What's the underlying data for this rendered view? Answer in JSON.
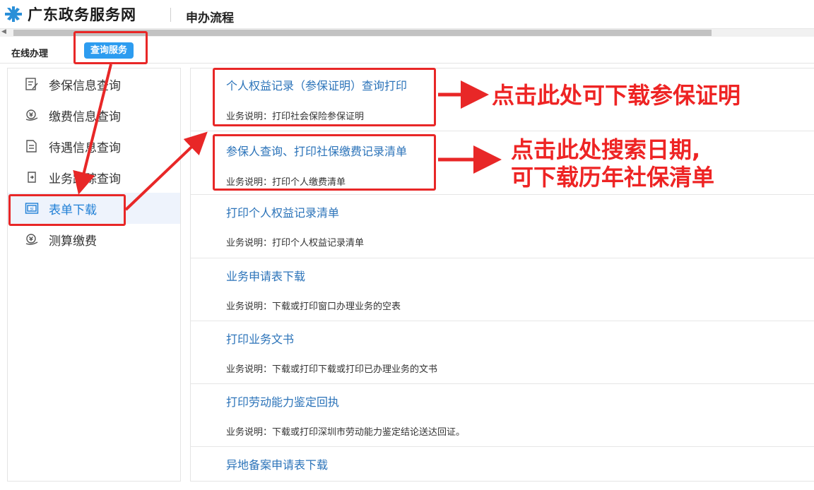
{
  "header": {
    "site_title": "广东政务服务网",
    "page_title": "申办流程"
  },
  "tabs": {
    "online": "在线办理",
    "query": "查询服务"
  },
  "sidebar": {
    "items": [
      {
        "label": "参保信息查询",
        "icon": "form-edit-icon"
      },
      {
        "label": "缴费信息查询",
        "icon": "payment-icon"
      },
      {
        "label": "待遇信息查询",
        "icon": "document-icon"
      },
      {
        "label": "业务跟踪查询",
        "icon": "tracking-icon"
      },
      {
        "label": "表单下载",
        "icon": "si-form-icon"
      },
      {
        "label": "测算缴费",
        "icon": "calculate-icon"
      }
    ],
    "active_index": 4
  },
  "entries": [
    {
      "title": "个人权益记录（参保证明）查询打印",
      "desc": "业务说明：打印社会保险参保证明"
    },
    {
      "title": "参保人查询、打印社保缴费记录清单",
      "desc": "业务说明：打印个人缴费清单"
    },
    {
      "title": "打印个人权益记录清单",
      "desc": "业务说明：打印个人权益记录清单"
    },
    {
      "title": "业务申请表下载",
      "desc": "业务说明：下载或打印窗口办理业务的空表"
    },
    {
      "title": "打印业务文书",
      "desc": "业务说明：下载或打印下载或打印已办理业务的文书"
    },
    {
      "title": "打印劳动能力鉴定回执",
      "desc": "业务说明：下载或打印深圳市劳动能力鉴定结论送达回证。"
    },
    {
      "title": "异地备案申请表下载",
      "desc": ""
    }
  ],
  "annotations": {
    "callout_1": "点击此处可下载参保证明",
    "callout_2_line1": "点击此处搜索日期,",
    "callout_2_line2": "可下载历年社保清单"
  },
  "colors": {
    "accent_blue": "#2d9cf0",
    "link_blue": "#2b73b9",
    "annotation_red": "#e82727"
  }
}
